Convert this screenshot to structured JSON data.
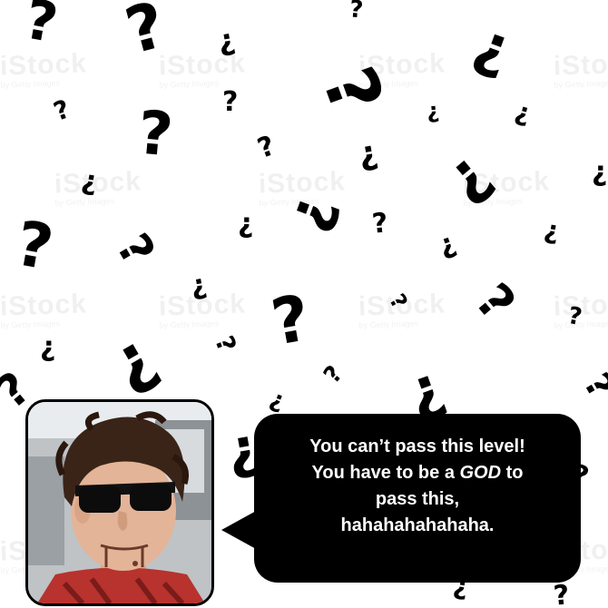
{
  "speech": {
    "line1": "You can’t pass this level!",
    "line2_a": "You have to be a ",
    "line2_b": "GOD",
    "line2_c": " to",
    "line3": "pass this,",
    "line4": "hahahahahahaha."
  },
  "background": {
    "watermark_brand": "iStock",
    "watermark_sub": "by Getty Images"
  },
  "icons": {
    "pattern": "question-mark-icon",
    "speaker": "puppet-avatar"
  },
  "colors": {
    "background": "#ffffff",
    "marks": "#000000",
    "bubble": "#000000",
    "bubble_text": "#ffffff"
  }
}
